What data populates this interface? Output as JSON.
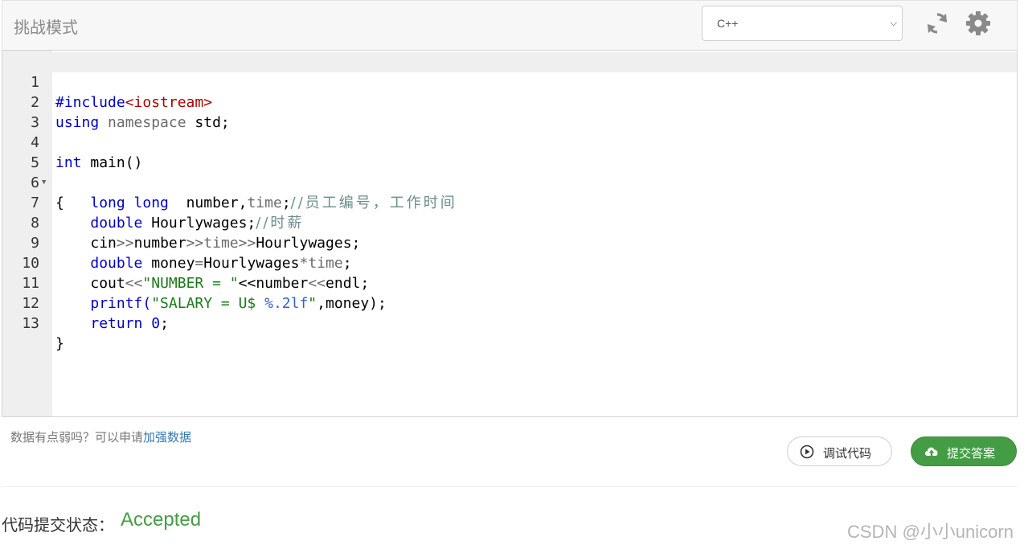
{
  "header": {
    "mode_title": "挑战模式",
    "language_selected": "C++"
  },
  "editor": {
    "lines": [
      {
        "n": "1"
      },
      {
        "n": "2"
      },
      {
        "n": "3"
      },
      {
        "n": "4"
      },
      {
        "n": "5"
      },
      {
        "n": "6"
      },
      {
        "n": "7"
      },
      {
        "n": "8"
      },
      {
        "n": "9"
      },
      {
        "n": "10"
      },
      {
        "n": "11"
      },
      {
        "n": "12"
      },
      {
        "n": "13"
      }
    ],
    "code": {
      "l1_include": "#include",
      "l1_lib": "<iostream>",
      "l2_using": "using",
      "l2_namespace": "namespace",
      "l2_rest": " std;",
      "l4_int": "int",
      "l4_rest": " main()",
      "l5": "{",
      "l6_type": "long long",
      "l6_vars": "  number,",
      "l6_time": "time",
      "l6_semi": ";",
      "l6_comment": "//员工编号，工作时间",
      "l7_type": "double",
      "l7_rest": " Hourlywages;",
      "l7_comment": "//时薪",
      "l8_a": "cin",
      "l8_op1": ">>",
      "l8_b": "number",
      "l8_op2": ">>",
      "l8_c": "time",
      "l8_op3": ">>",
      "l8_d": "Hourlywages;",
      "l9_type": "double",
      "l9_a": " money",
      "l9_eq": "=",
      "l9_b": "Hourlywages",
      "l9_star": "*",
      "l9_c": "time",
      "l9_semi": ";",
      "l10_a": "cout",
      "l10_op1": "<<",
      "l10_str": "\"NUMBER = \"",
      "l10_op2": "<<",
      "l10_b": "number",
      "l10_op3": "<<",
      "l10_c": "endl;",
      "l11_a": "printf(",
      "l11_str1": "\"SALARY = U$ ",
      "l11_fmt": "%.2lf",
      "l11_str2": "\"",
      "l11_rest": ",money);",
      "l12_kw": "return",
      "l12_sp": " ",
      "l12_num": "0",
      "l12_semi": ";",
      "l13": "}"
    }
  },
  "hint": {
    "text": "数据有点弱吗？可以申请",
    "link": "加强数据"
  },
  "buttons": {
    "debug": "调试代码",
    "submit": "提交答案"
  },
  "status": {
    "label": "代码提交状态：",
    "value": "Accepted"
  },
  "watermark": "CSDN @小小unicorn"
}
